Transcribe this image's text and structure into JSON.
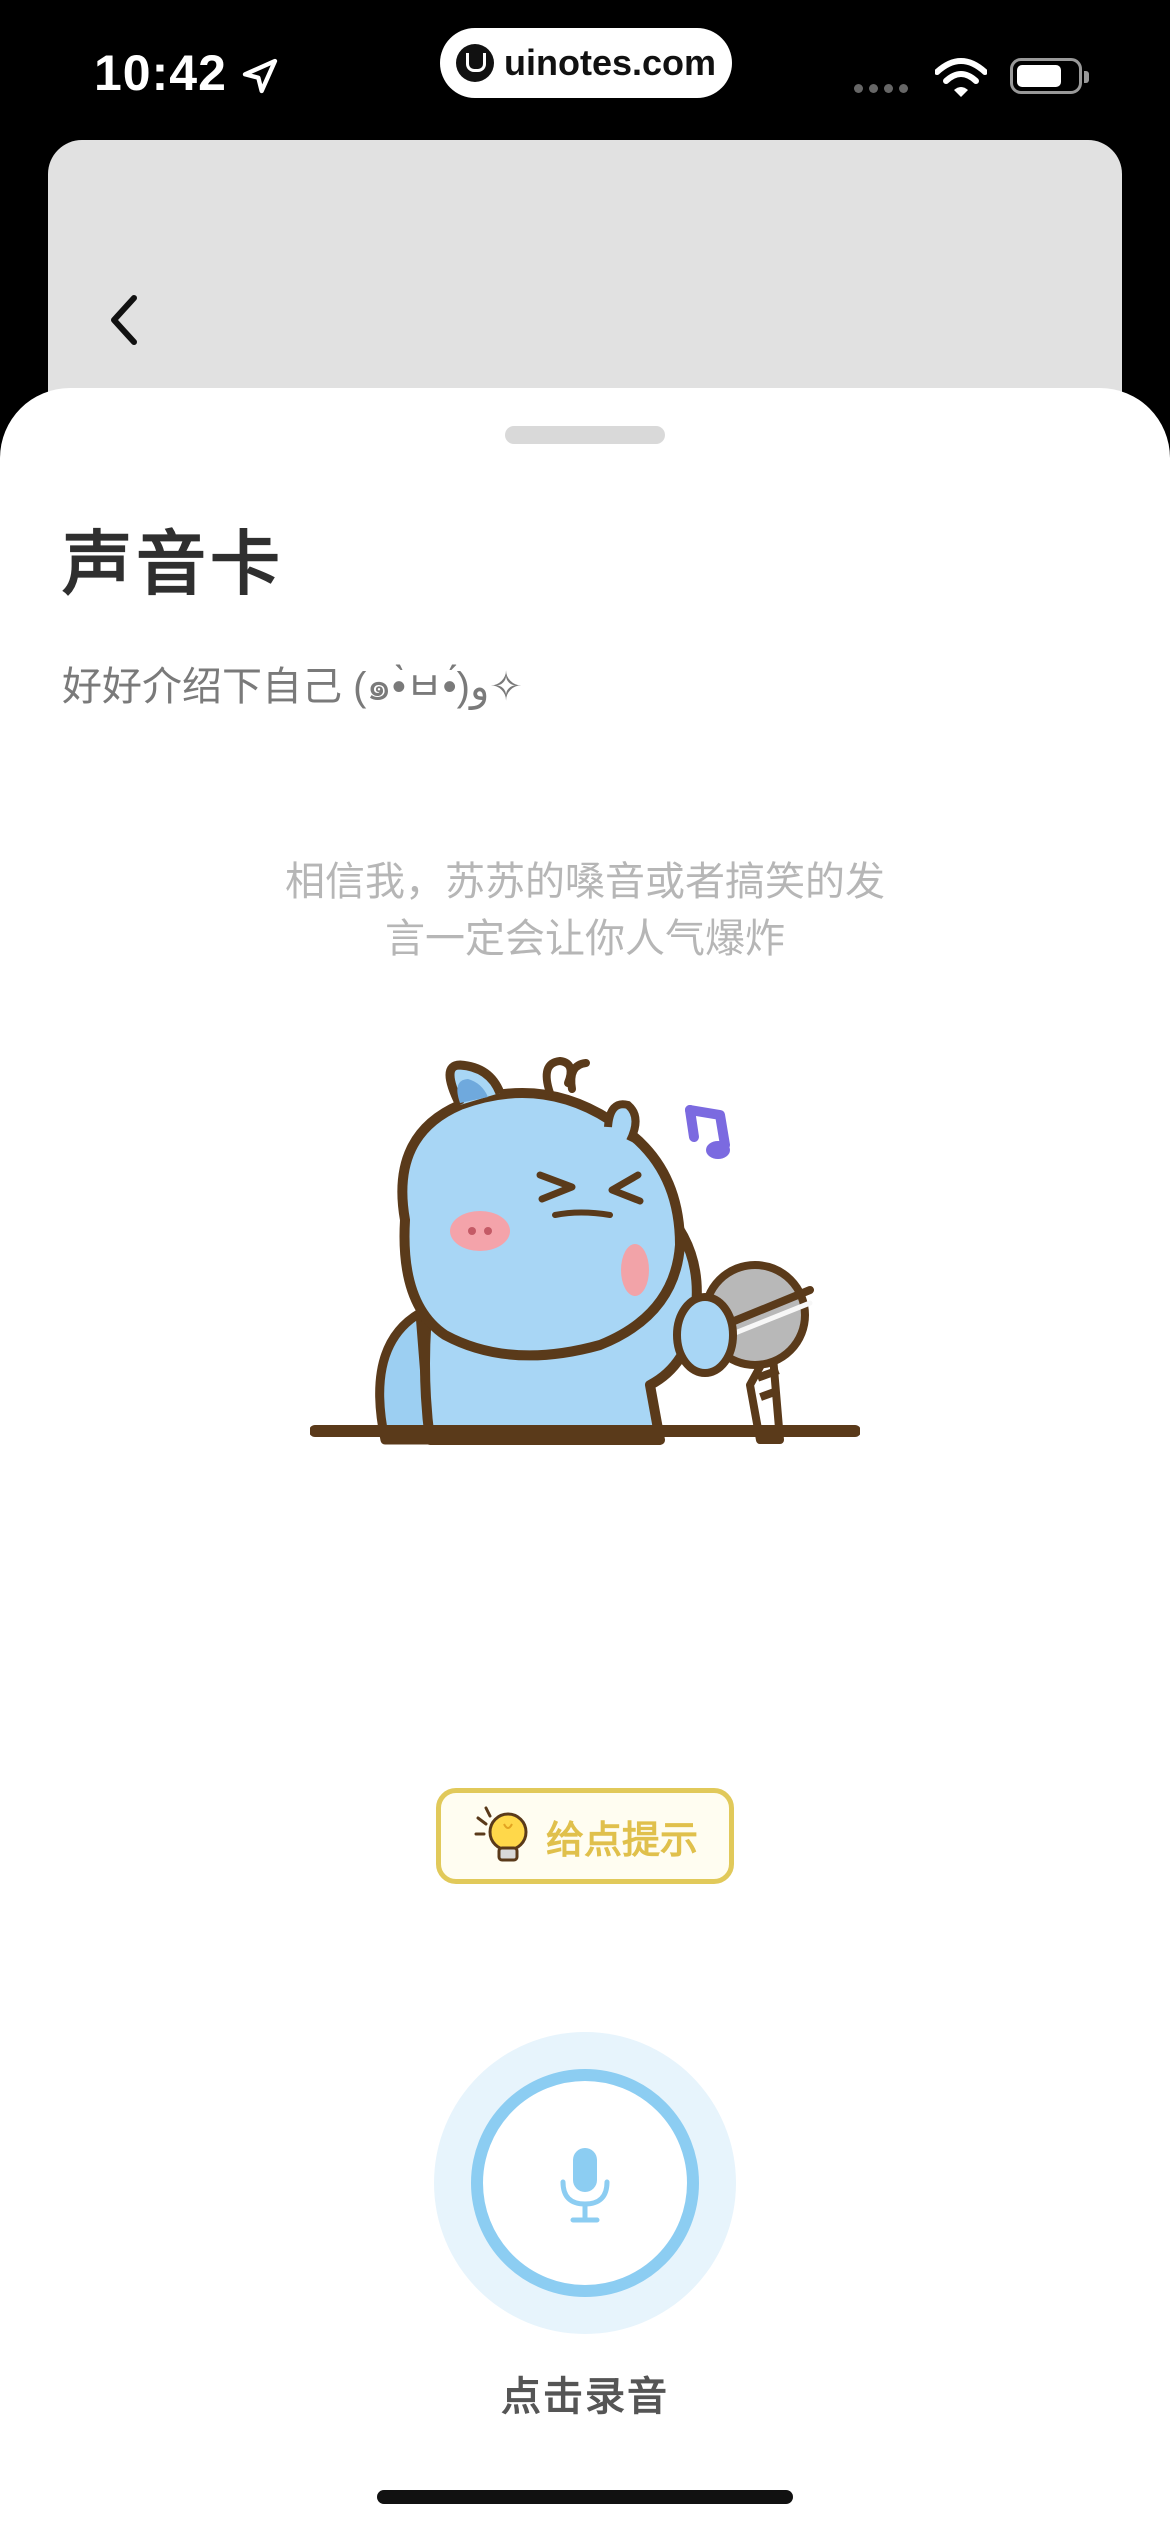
{
  "status_bar": {
    "time": "10:42",
    "watermark": "uinotes.com"
  },
  "page": {
    "title": "声音卡",
    "subtitle": "好好介绍下自己 (๑•̀ㅂ•́)و✧",
    "hint_lines": [
      "相信我，苏苏的嗓音或者搞笑的发",
      "言一定会让你人气爆炸"
    ],
    "tip_button_label": "给点提示",
    "record_label": "点击录音"
  },
  "colors": {
    "accent_blue": "#8ccdf2",
    "tip_yellow": "#e0c04c",
    "note_purple": "#7b6ae0"
  },
  "icons": {
    "back": "chevron-left-icon",
    "mic": "microphone-icon",
    "tip": "lightbulb-icon"
  }
}
